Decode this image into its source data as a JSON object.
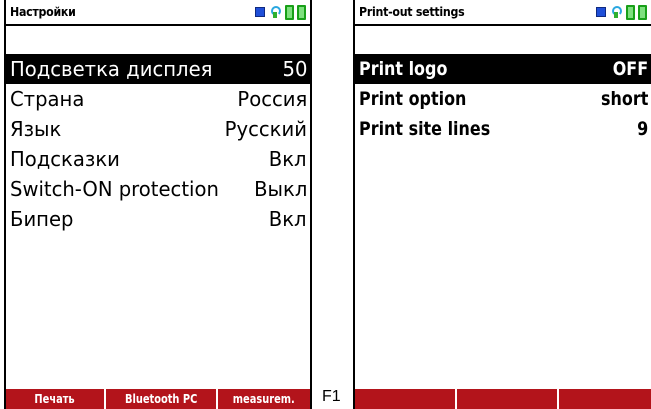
{
  "left_screen": {
    "title": "Настройки",
    "items": [
      {
        "label": "Подсветка дисплея",
        "value": "50",
        "selected": true
      },
      {
        "label": "Страна",
        "value": "Россия",
        "selected": false
      },
      {
        "label": "Язык",
        "value": "Русский",
        "selected": false
      },
      {
        "label": "Подсказки",
        "value": "Вкл",
        "selected": false
      },
      {
        "label": "Switch-ON protection",
        "value": "Выкл",
        "selected": false
      },
      {
        "label": "Бипер",
        "value": "Вкл",
        "selected": false
      }
    ],
    "softkeys": [
      "Печать",
      "Bluetooth PC",
      "measurem."
    ]
  },
  "right_screen": {
    "title": "Print-out settings",
    "items": [
      {
        "label": "Print logo",
        "value": "OFF",
        "selected": true
      },
      {
        "label": "Print option",
        "value": "short",
        "selected": false
      },
      {
        "label": "Print site lines",
        "value": "9",
        "selected": false
      }
    ],
    "softkeys": [
      "",
      "",
      ""
    ]
  },
  "annotation": "F1",
  "status_icons": [
    "connection-icon",
    "sensor-icon",
    "battery-icon",
    "battery-icon"
  ],
  "colors": {
    "softkey_bar": "#b3141b",
    "selected_row": "#000000",
    "battery": "#7ee07e",
    "connection": "#1f4fd8"
  }
}
